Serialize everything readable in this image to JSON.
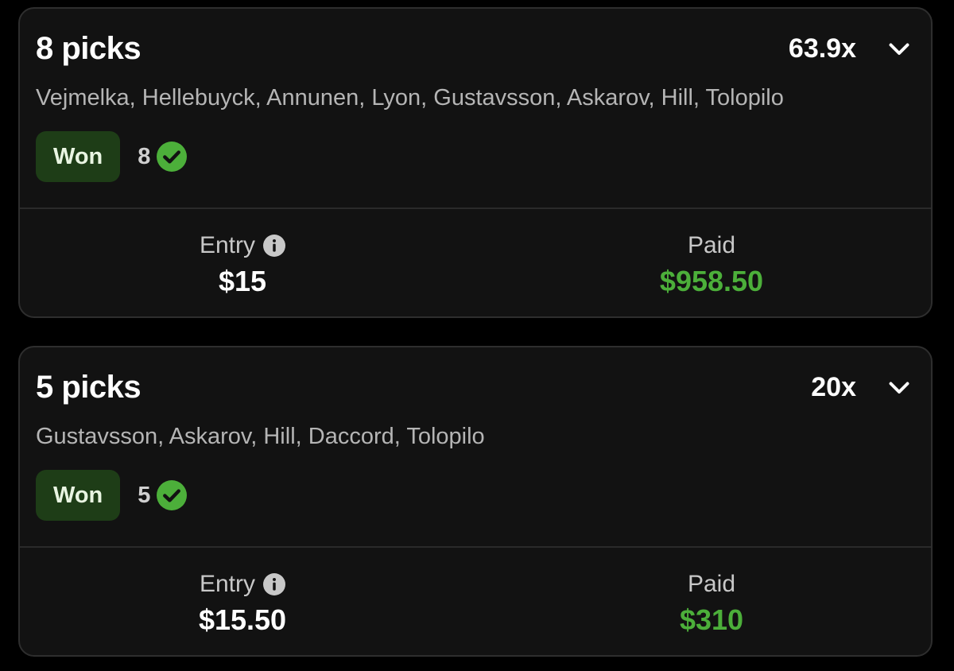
{
  "colors": {
    "background": "#000000",
    "card": "#121212",
    "won_badge_bg": "#1e3d17",
    "success_green": "#4caf3a"
  },
  "entries": [
    {
      "title": "8 picks",
      "multiplier": "63.9x",
      "players": "Vejmelka, Hellebuyck, Annunen, Lyon, Gustavsson, Askarov, Hill, Tolopilo",
      "status": "Won",
      "hits": "8",
      "entry_label": "Entry",
      "entry_value": "$15",
      "paid_label": "Paid",
      "paid_value": "$958.50",
      "icons": [
        "chevron-down-icon",
        "check-circle-icon",
        "info-icon"
      ]
    },
    {
      "title": "5 picks",
      "multiplier": "20x",
      "players": "Gustavsson, Askarov, Hill, Daccord, Tolopilo",
      "status": "Won",
      "hits": "5",
      "entry_label": "Entry",
      "entry_value": "$15.50",
      "paid_label": "Paid",
      "paid_value": "$310",
      "icons": [
        "chevron-down-icon",
        "check-circle-icon",
        "info-icon"
      ]
    }
  ]
}
